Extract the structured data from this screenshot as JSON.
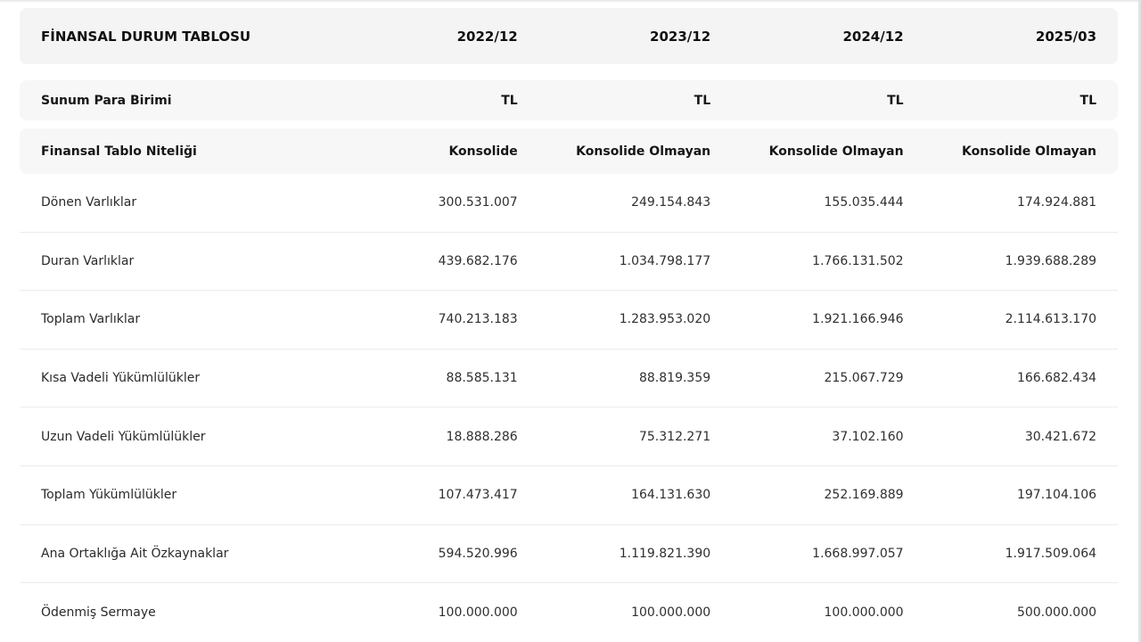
{
  "table": {
    "title": "FİNANSAL DURUM TABLOSU",
    "periods": [
      "2022/12",
      "2023/12",
      "2024/12",
      "2025/03"
    ],
    "currency_row": {
      "label": "Sunum Para Birimi",
      "values": [
        "TL",
        "TL",
        "TL",
        "TL"
      ]
    },
    "nature_row": {
      "label": "Finansal Tablo Niteliği",
      "values": [
        "Konsolide",
        "Konsolide Olmayan",
        "Konsolide Olmayan",
        "Konsolide Olmayan"
      ]
    },
    "rows": [
      {
        "label": "Dönen Varlıklar",
        "values": [
          "300.531.007",
          "249.154.843",
          "155.035.444",
          "174.924.881"
        ]
      },
      {
        "label": "Duran Varlıklar",
        "values": [
          "439.682.176",
          "1.034.798.177",
          "1.766.131.502",
          "1.939.688.289"
        ]
      },
      {
        "label": "Toplam Varlıklar",
        "values": [
          "740.213.183",
          "1.283.953.020",
          "1.921.166.946",
          "2.114.613.170"
        ]
      },
      {
        "label": "Kısa Vadeli Yükümlülükler",
        "values": [
          "88.585.131",
          "88.819.359",
          "215.067.729",
          "166.682.434"
        ]
      },
      {
        "label": "Uzun Vadeli Yükümlülükler",
        "values": [
          "18.888.286",
          "75.312.271",
          "37.102.160",
          "30.421.672"
        ]
      },
      {
        "label": "Toplam Yükümlülükler",
        "values": [
          "107.473.417",
          "164.131.630",
          "252.169.889",
          "197.104.106"
        ]
      },
      {
        "label": "Ana Ortaklığa Ait Özkaynaklar",
        "values": [
          "594.520.996",
          "1.119.821.390",
          "1.668.997.057",
          "1.917.509.064"
        ]
      },
      {
        "label": "Ödenmiş Sermaye",
        "values": [
          "100.000.000",
          "100.000.000",
          "100.000.000",
          "500.000.000"
        ]
      }
    ]
  }
}
